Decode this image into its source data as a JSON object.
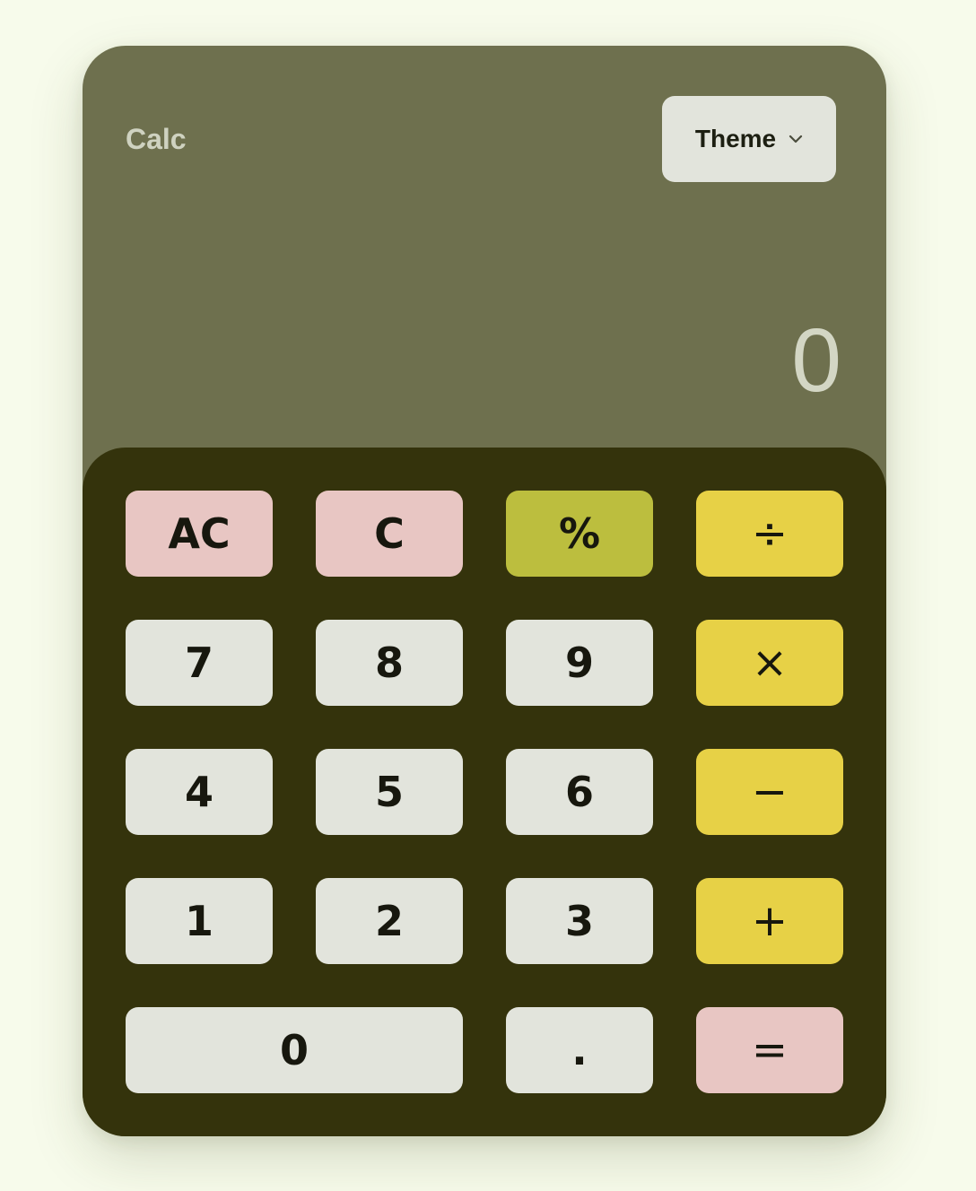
{
  "app": {
    "title": "Calc"
  },
  "theme_button": {
    "label": "Theme",
    "icon": "chevron-down-icon"
  },
  "display": {
    "value": "0"
  },
  "keys": {
    "ac": "AC",
    "c": "C",
    "percent": "%",
    "divide": "÷",
    "seven": "7",
    "eight": "8",
    "nine": "9",
    "multiply": "×",
    "four": "4",
    "five": "5",
    "six": "6",
    "minus": "−",
    "one": "1",
    "two": "2",
    "three": "3",
    "plus": "+",
    "zero": "0",
    "decimal": ".",
    "equals": "="
  },
  "colors": {
    "page_background": "#f7fbeb",
    "display_panel": "#6e704e",
    "keypad_panel": "#34330c",
    "number_key": "#e2e4dc",
    "clear_key": "#e8c6c3",
    "percent_key": "#bcbe3e",
    "operator_key": "#e7d146",
    "equals_key": "#e8c6c3"
  }
}
